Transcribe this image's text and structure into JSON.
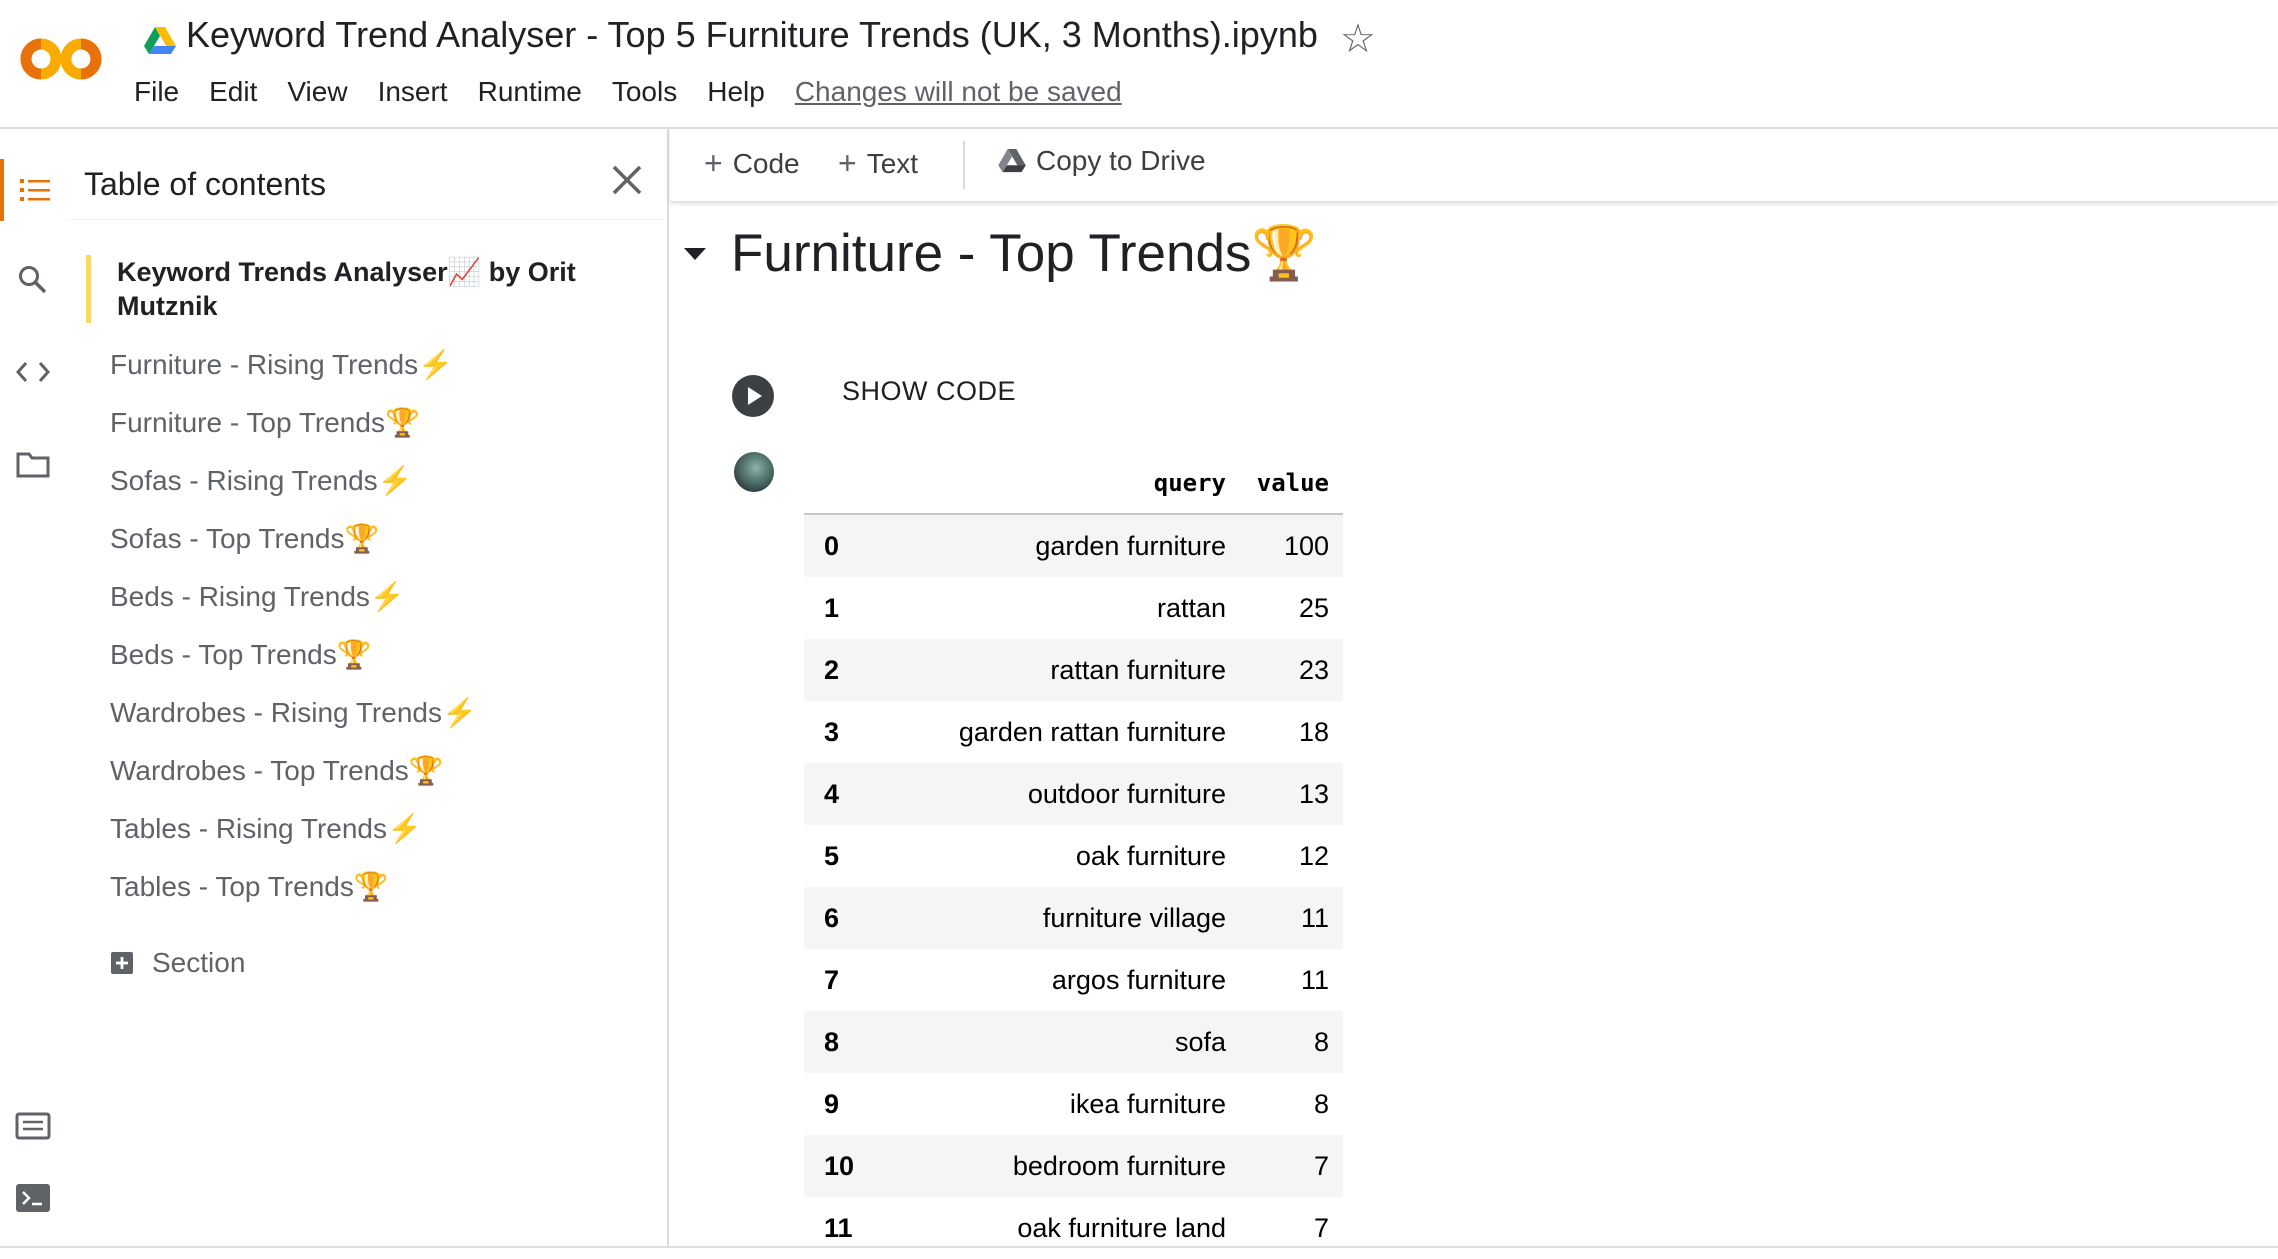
{
  "header": {
    "title": "Keyword Trend Analyser - Top 5 Furniture Trends (UK, 3 Months).ipynb",
    "star_icon": "star-outline-icon",
    "menu": [
      "File",
      "Edit",
      "View",
      "Insert",
      "Runtime",
      "Tools",
      "Help"
    ],
    "unsaved_notice": "Changes will not be saved"
  },
  "brand": {
    "logo_text": "CO",
    "logo_color": "#f9ab00",
    "accent_color": "#e8710a"
  },
  "rail": {
    "icons": [
      "toc-icon",
      "search-icon",
      "code-snippets-icon",
      "folder-icon",
      "command-palette-icon",
      "terminal-icon"
    ]
  },
  "toc": {
    "title": "Table of contents",
    "heading": "Keyword Trends Analyser📈 by Orit Mutznik",
    "items": [
      "Furniture - Rising Trends⚡",
      "Furniture - Top Trends🏆",
      "Sofas - Rising Trends⚡",
      "Sofas - Top Trends🏆",
      "Beds - Rising Trends⚡",
      "Beds - Top Trends🏆",
      "Wardrobes - Rising Trends⚡",
      "Wardrobes - Top Trends🏆",
      "Tables - Rising Trends⚡",
      "Tables - Top Trends🏆"
    ],
    "add_section_label": "Section"
  },
  "toolbar": {
    "code_label": "Code",
    "text_label": "Text",
    "copy_label": "Copy to Drive"
  },
  "notebook": {
    "section_title": "Furniture - Top Trends🏆",
    "show_code_label": "SHOW CODE",
    "table": {
      "columns": [
        "query",
        "value"
      ],
      "rows": [
        [
          "0",
          "garden furniture",
          "100"
        ],
        [
          "1",
          "rattan",
          "25"
        ],
        [
          "2",
          "rattan furniture",
          "23"
        ],
        [
          "3",
          "garden rattan furniture",
          "18"
        ],
        [
          "4",
          "outdoor furniture",
          "13"
        ],
        [
          "5",
          "oak furniture",
          "12"
        ],
        [
          "6",
          "furniture village",
          "11"
        ],
        [
          "7",
          "argos furniture",
          "11"
        ],
        [
          "8",
          "sofa",
          "8"
        ],
        [
          "9",
          "ikea furniture",
          "8"
        ],
        [
          "10",
          "bedroom furniture",
          "7"
        ],
        [
          "11",
          "oak furniture land",
          "7"
        ]
      ]
    }
  }
}
